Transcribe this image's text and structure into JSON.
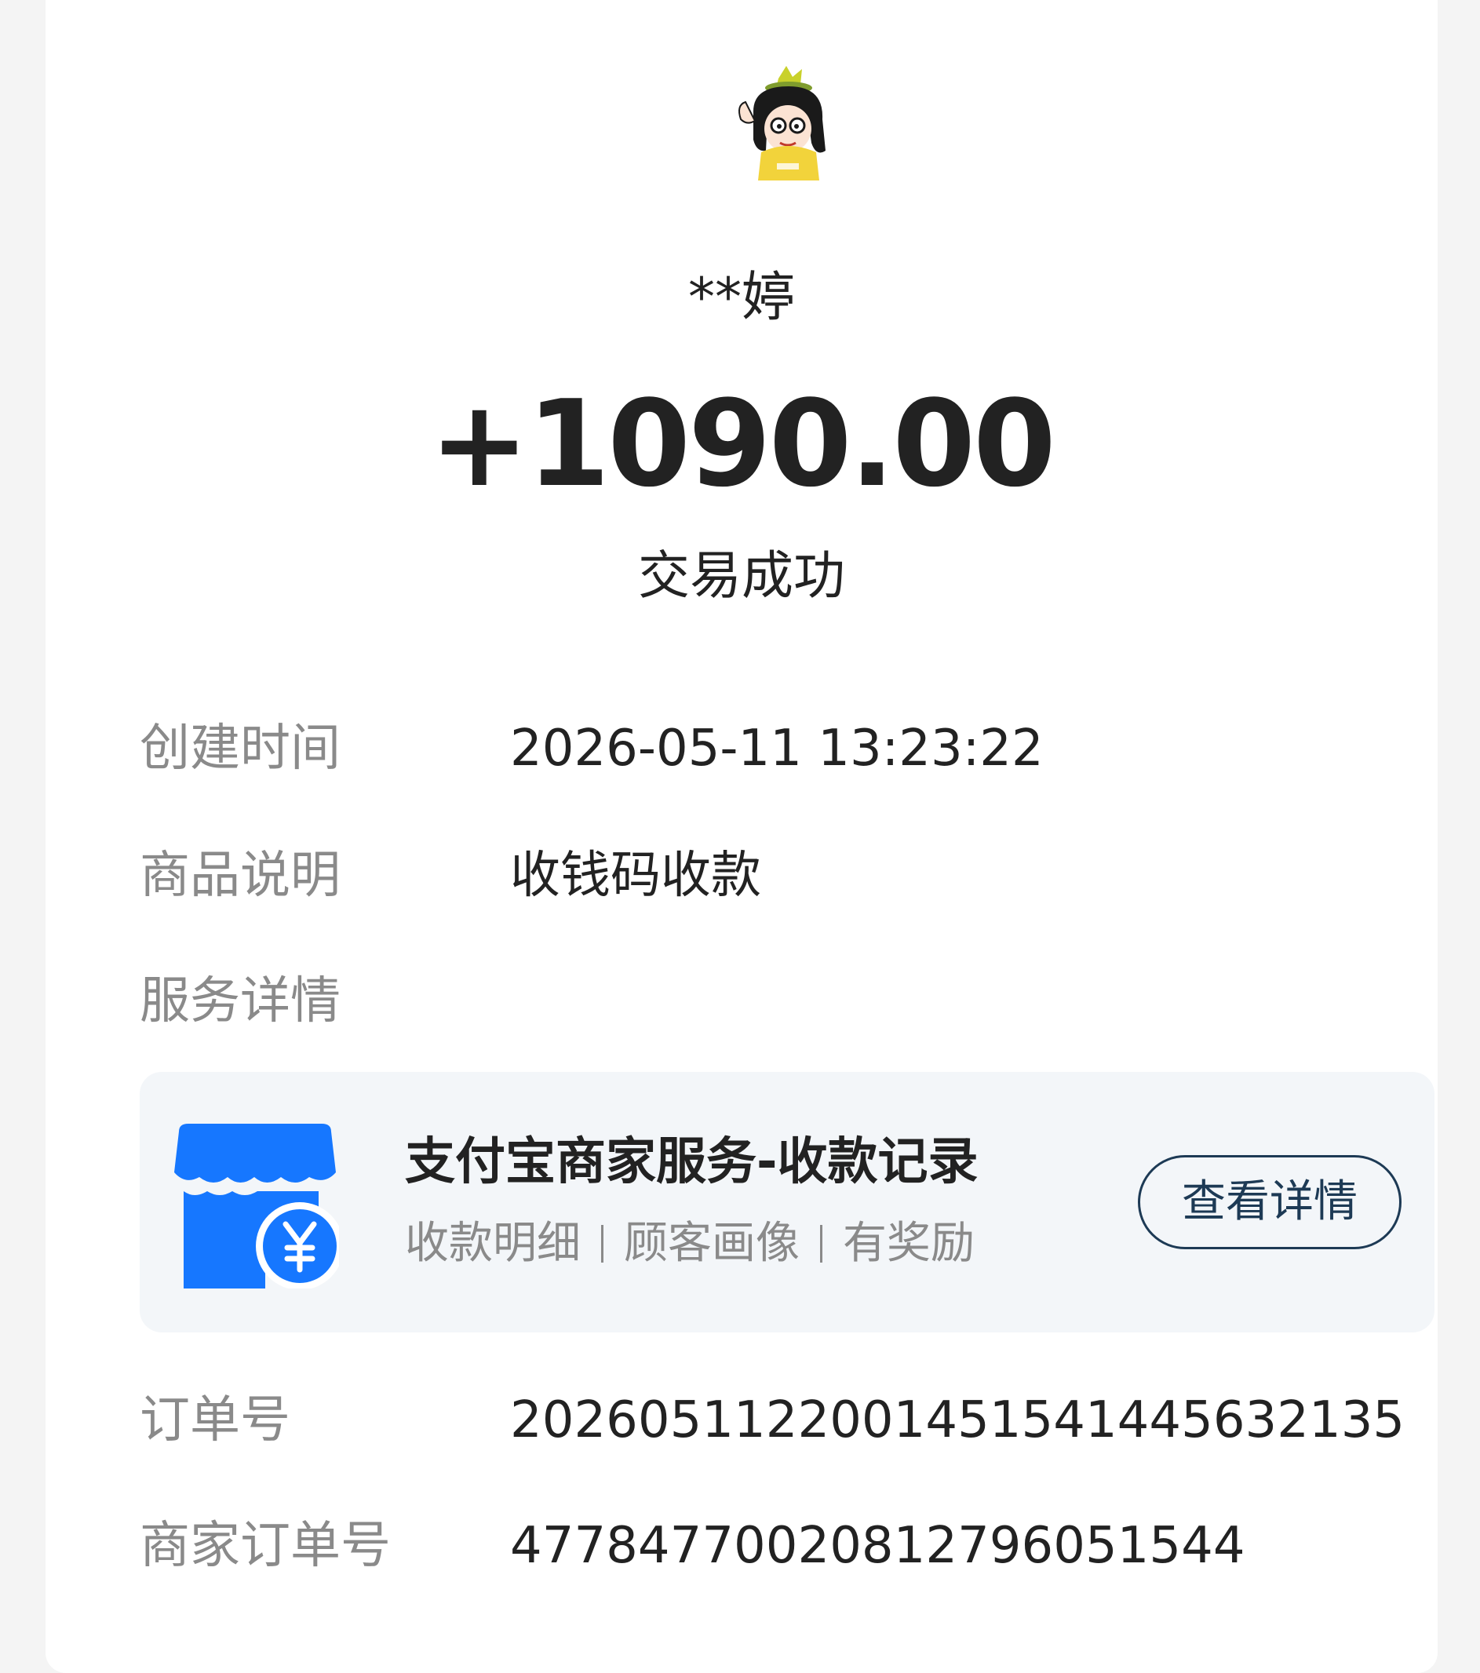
{
  "payer": {
    "name": "**婷"
  },
  "transaction": {
    "amount": "+1090.00",
    "status": "交易成功"
  },
  "details": {
    "created_time_label": "创建时间",
    "created_time_value": "2026-05-11 13:23:22",
    "product_label": "商品说明",
    "product_value": "收钱码收款",
    "service_label": "服务详情",
    "order_no_label": "订单号",
    "order_no_value": "2026051122001451541445632135",
    "merchant_order_label": "商家订单号",
    "merchant_order_value": "4778477002081279605154​4"
  },
  "service_card": {
    "title": "支付宝商家服务-收款记录",
    "sub_items": [
      "收款明细",
      "顾客画像",
      "有奖励"
    ],
    "button_label": "查看详情",
    "icon": "shop-yuan-icon",
    "accent_color": "#1677ff"
  }
}
